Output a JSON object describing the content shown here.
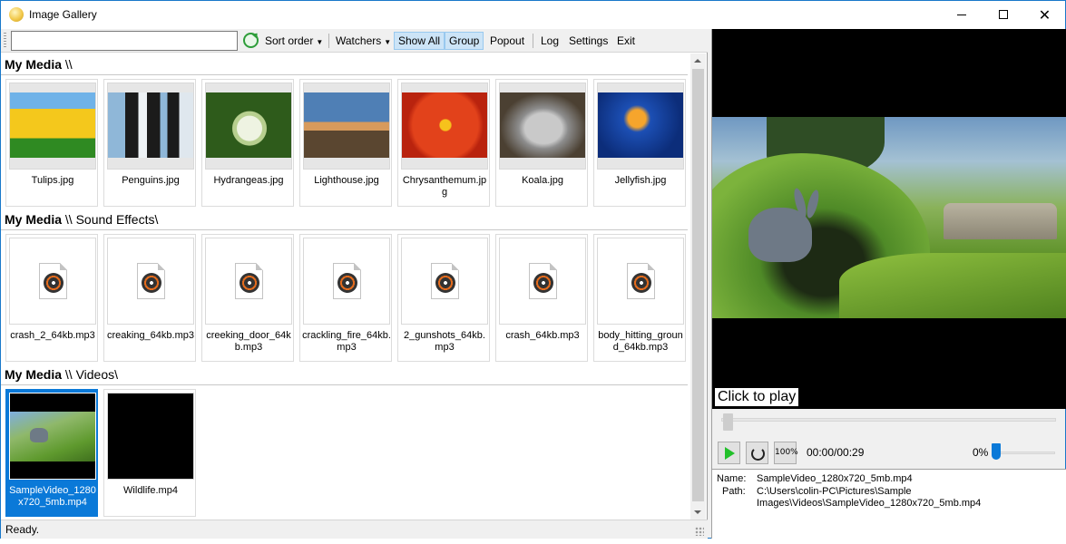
{
  "window": {
    "title": "Image Gallery"
  },
  "toolbar": {
    "search_value": "",
    "sort_order": "Sort order",
    "watchers": "Watchers",
    "show_all": "Show All",
    "group": "Group",
    "popout": "Popout",
    "log": "Log",
    "settings": "Settings",
    "exit": "Exit"
  },
  "groups": [
    {
      "root": "My Media",
      "path": "\\\\",
      "items": [
        {
          "name": "Tulips.jpg"
        },
        {
          "name": "Penguins.jpg"
        },
        {
          "name": "Hydrangeas.jpg"
        },
        {
          "name": "Lighthouse.jpg"
        },
        {
          "name": "Chrysanthemum.jpg"
        },
        {
          "name": "Koala.jpg"
        },
        {
          "name": "Jellyfish.jpg"
        }
      ]
    },
    {
      "root": "My Media",
      "path": "\\\\ Sound Effects\\",
      "items": [
        {
          "name": "crash_2_64kb.mp3"
        },
        {
          "name": "creaking_64kb.mp3"
        },
        {
          "name": "creeking_door_64kb.mp3"
        },
        {
          "name": "crackling_fire_64kb.mp3"
        },
        {
          "name": "2_gunshots_64kb.mp3"
        },
        {
          "name": "crash_64kb.mp3"
        },
        {
          "name": "body_hitting_ground_64kb.mp3"
        }
      ]
    },
    {
      "root": "My Media",
      "path": "\\\\ Videos\\",
      "items": [
        {
          "name": "SampleVideo_1280x720_5mb.mp4",
          "selected": true
        },
        {
          "name": "Wildlife.mp4"
        }
      ]
    }
  ],
  "status": "Ready.",
  "player": {
    "overlay": "Click to play",
    "time": "00:00/00:29",
    "volume": "0%",
    "zoom_label": "100%",
    "seek_fraction": 0,
    "volume_fraction": 0
  },
  "info": {
    "name_label": "Name:",
    "path_label": "Path:",
    "name": "SampleVideo_1280x720_5mb.mp4",
    "path": "C:\\Users\\colin-PC\\Pictures\\Sample Images\\Videos\\SampleVideo_1280x720_5mb.mp4"
  }
}
